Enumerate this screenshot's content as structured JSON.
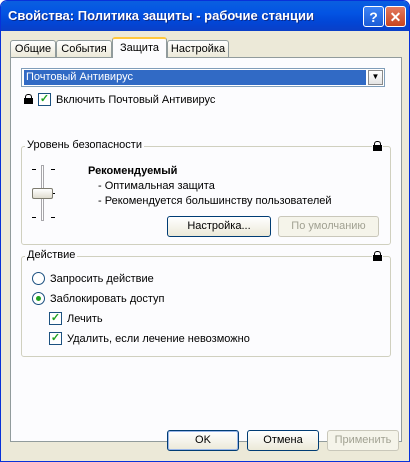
{
  "window": {
    "title": "Свойства: Политика защиты - рабочие станции",
    "help_glyph": "?",
    "close_glyph": "✕"
  },
  "tabs": [
    {
      "label": "Общие"
    },
    {
      "label": "События"
    },
    {
      "label": "Защита"
    },
    {
      "label": "Настройка"
    }
  ],
  "component_select": {
    "value": "Почтовый Антивирус",
    "arrow_glyph": "▼"
  },
  "enable_component": {
    "label": "Включить Почтовый Антивирус",
    "checked": true,
    "check_glyph": "✓"
  },
  "security_level": {
    "group_title": "Уровень безопасности",
    "level_name": "Рекомендуемый",
    "description": [
      "- Оптимальная защита",
      "- Рекомендуется большинству пользователей"
    ],
    "slider_position": "middle",
    "settings_button": "Настройка...",
    "default_button": "По умолчанию"
  },
  "action": {
    "group_title": "Действие",
    "options": [
      {
        "label": "Запросить действие",
        "checked": false
      },
      {
        "label": "Заблокировать доступ",
        "checked": true
      }
    ],
    "sub_options": [
      {
        "label": "Лечить",
        "checked": true
      },
      {
        "label": "Удалить, если лечение невозможно",
        "checked": true
      }
    ]
  },
  "footer": {
    "ok": "OK",
    "cancel": "Отмена",
    "apply": "Применить"
  },
  "colors": {
    "titlebar": "#0354e3",
    "selection": "#316ac5",
    "check": "#21a121"
  }
}
